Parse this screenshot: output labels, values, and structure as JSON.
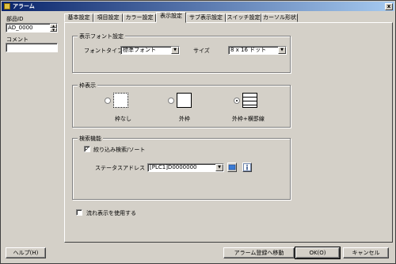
{
  "window": {
    "title": "アラーム",
    "close_glyph": "x"
  },
  "sidebar": {
    "part_id_label": "部品ID",
    "part_id_value": "AD_0000",
    "comment_label": "コメント",
    "comment_value": ""
  },
  "tabs": [
    {
      "label": "基本設定"
    },
    {
      "label": "項目設定"
    },
    {
      "label": "カラー設定"
    },
    {
      "label": "表示設定"
    },
    {
      "label": "サブ表示設定"
    },
    {
      "label": "スイッチ設定"
    },
    {
      "label": "カーソル形状"
    }
  ],
  "active_tab": "表示設定",
  "font_group": {
    "title": "表示フォント設定",
    "font_type_label": "フォントタイプ",
    "font_type_value": "標準フォント",
    "size_label": "サイズ",
    "size_value": "8 x 16 ドット"
  },
  "frame_group": {
    "title": "枠表示",
    "options": [
      {
        "label": "枠なし",
        "selected": false
      },
      {
        "label": "外枠",
        "selected": false
      },
      {
        "label": "外枠+横罫線",
        "selected": true
      }
    ]
  },
  "search_group": {
    "title": "検索機能",
    "filter_label": "絞り込み検索/ソート",
    "filter_checked": true,
    "status_address_label": "ステータスアドレス",
    "status_address_value": "[PLC1]D0000000"
  },
  "flow_display": {
    "label": "流れ表示を使用する",
    "checked": false
  },
  "footer": {
    "help_label": "ヘルプ(H)",
    "alarm_register_label": "アラーム登録へ移動",
    "ok_label": "OK(O)",
    "cancel_label": "キャンセル"
  }
}
